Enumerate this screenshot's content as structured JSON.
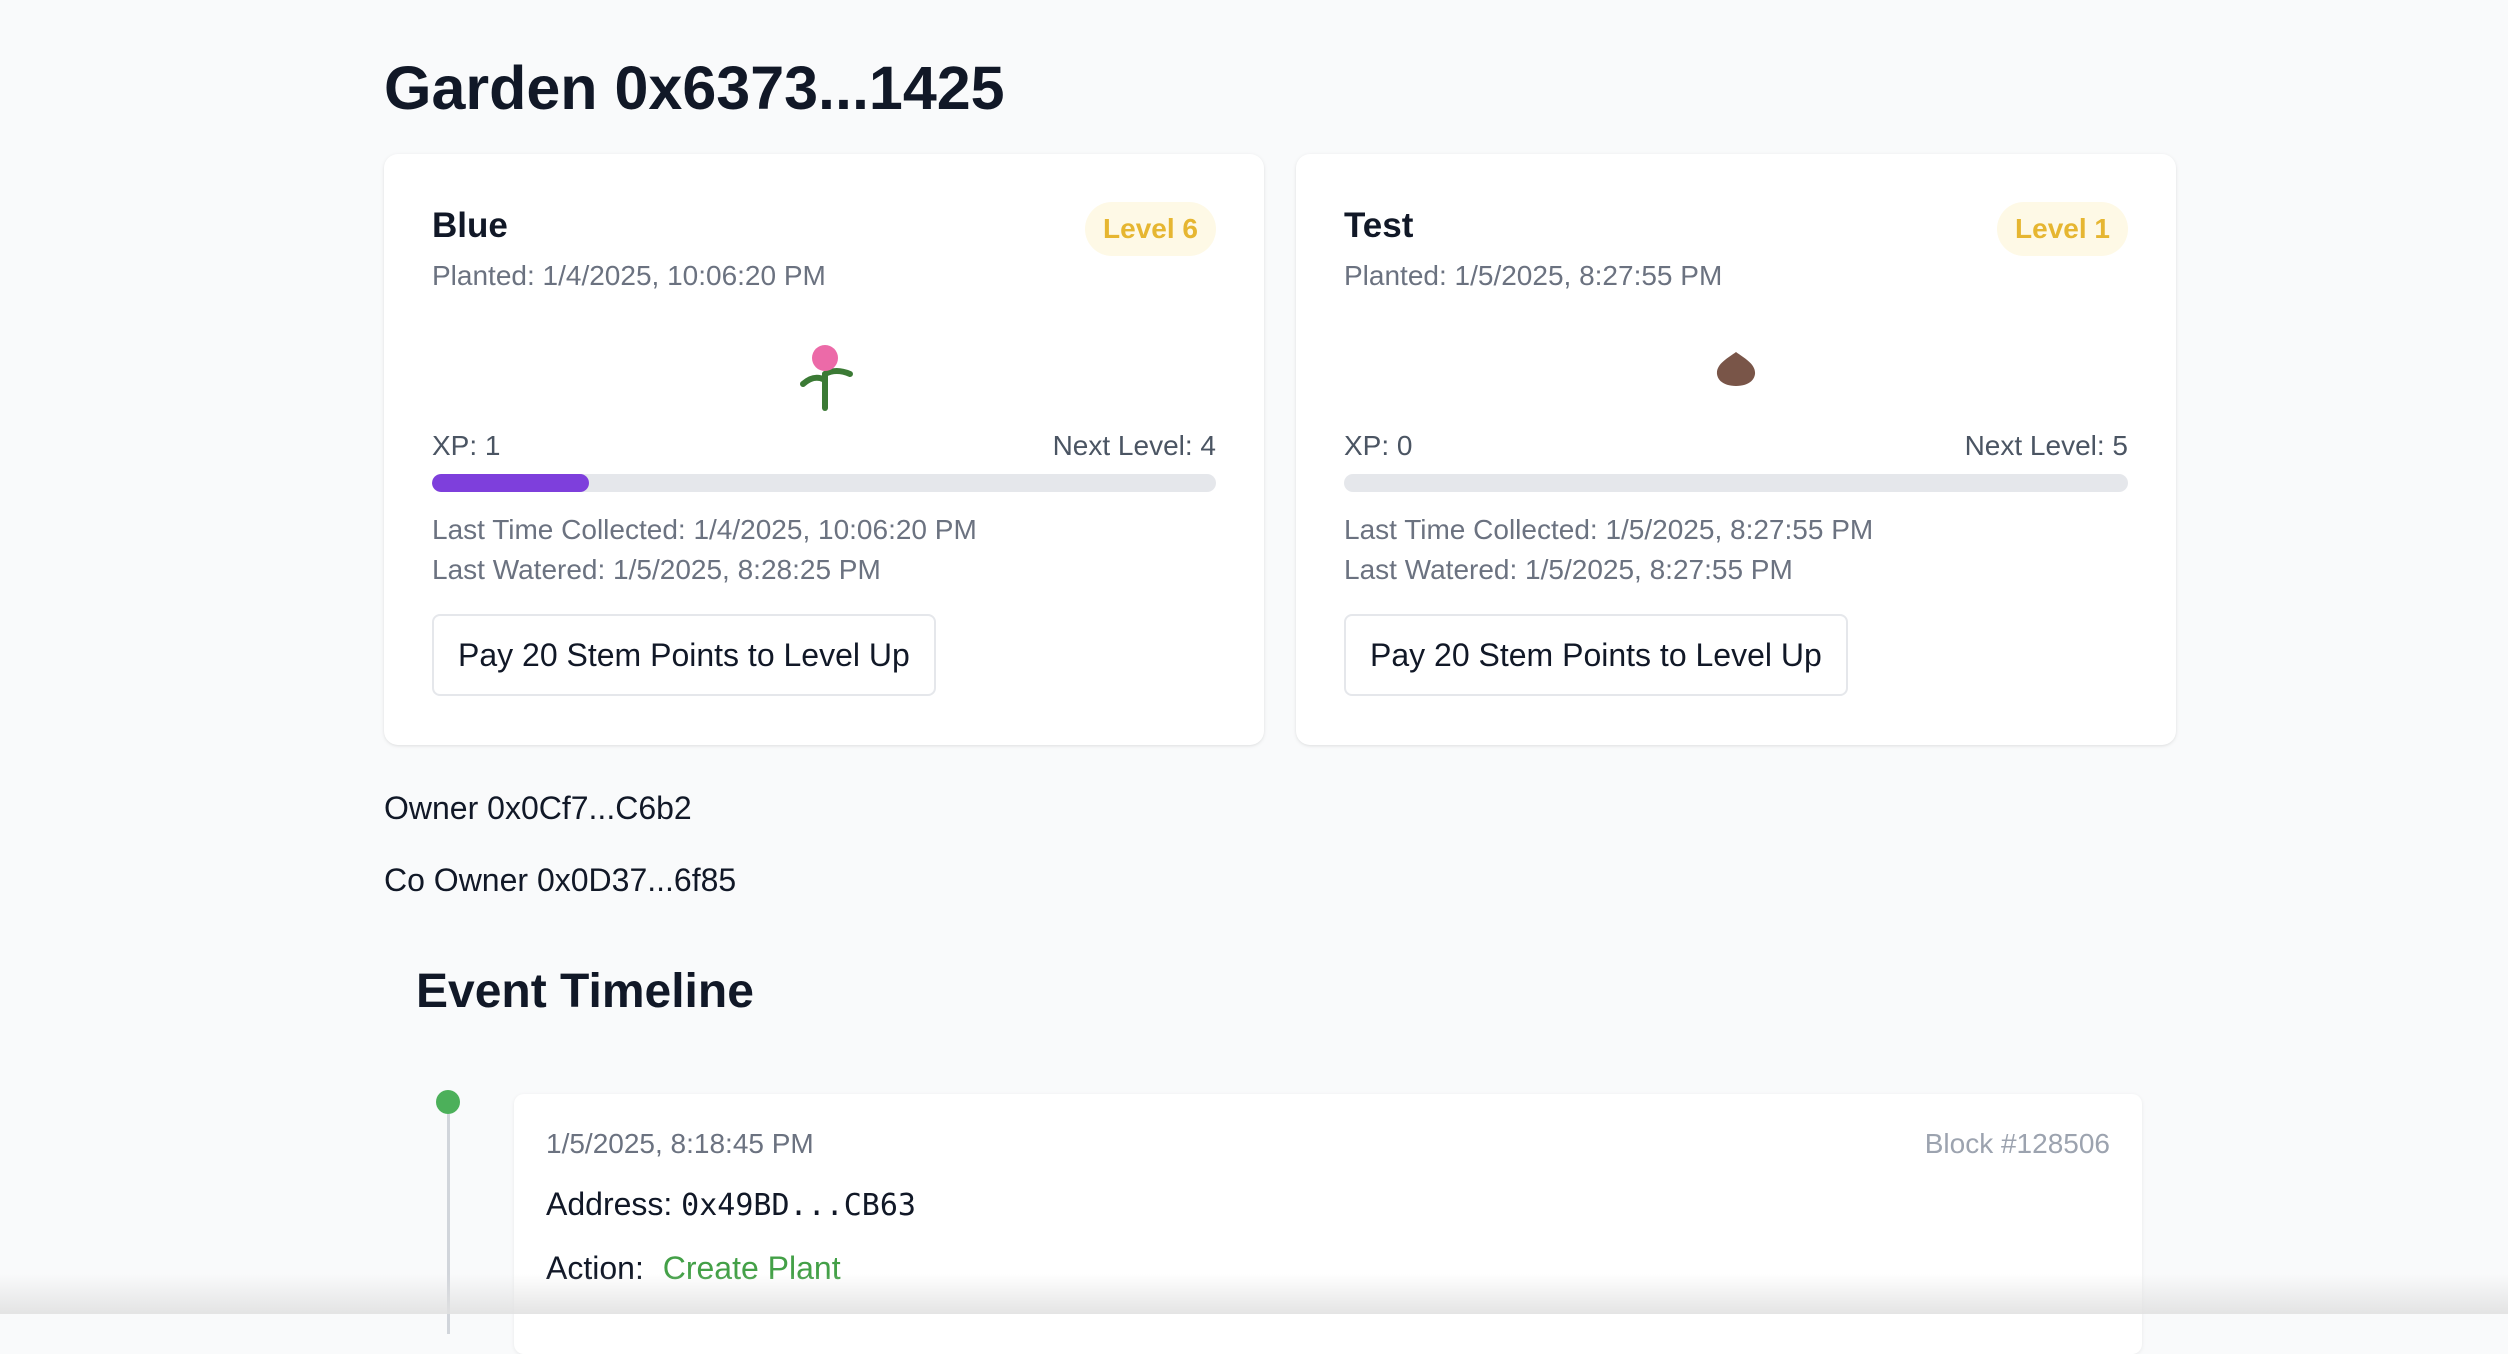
{
  "page": {
    "title": "Garden 0x6373...1425"
  },
  "plants": [
    {
      "name": "Blue",
      "level": "Level 6",
      "planted": "Planted: 1/4/2025, 10:06:20 PM",
      "icon": "flower-icon",
      "xp": "XP: 1",
      "next_level": "Next Level: 4",
      "progress_fraction": 0.2,
      "last_collected": "Last Time Collected: 1/4/2025, 10:06:20 PM",
      "last_watered": "Last Watered: 1/5/2025, 8:28:25 PM",
      "level_up_label": "Pay 20 Stem Points to Level Up"
    },
    {
      "name": "Test",
      "level": "Level 1",
      "planted": "Planted: 1/5/2025, 8:27:55 PM",
      "icon": "seed-icon",
      "xp": "XP: 0",
      "next_level": "Next Level: 5",
      "progress_fraction": 0,
      "last_collected": "Last Time Collected: 1/5/2025, 8:27:55 PM",
      "last_watered": "Last Watered: 1/5/2025, 8:27:55 PM",
      "level_up_label": "Pay 20 Stem Points to Level Up"
    }
  ],
  "owners": {
    "owner": "Owner 0x0Cf7...C6b2",
    "co_owner": "Co Owner 0x0D37...6f85"
  },
  "timeline": {
    "title": "Event Timeline",
    "events": [
      {
        "time": "1/5/2025, 8:18:45 PM",
        "block": "Block #128506",
        "address_label": "Address:",
        "address": "0x49BD...CB63",
        "action_label": "Action:",
        "action": "Create Plant"
      }
    ]
  },
  "colors": {
    "background": "#f9fafb",
    "progress_fill": "#7e3fdc",
    "progress_track": "#e5e7eb",
    "level_badge_text": "#e6b631",
    "level_badge_bg": "#fef9e6",
    "action_text": "#43a047",
    "timeline_dot": "#4cb05a",
    "flower_petal": "#ec6aa8",
    "stem": "#3b7a35",
    "seed": "#795548"
  }
}
